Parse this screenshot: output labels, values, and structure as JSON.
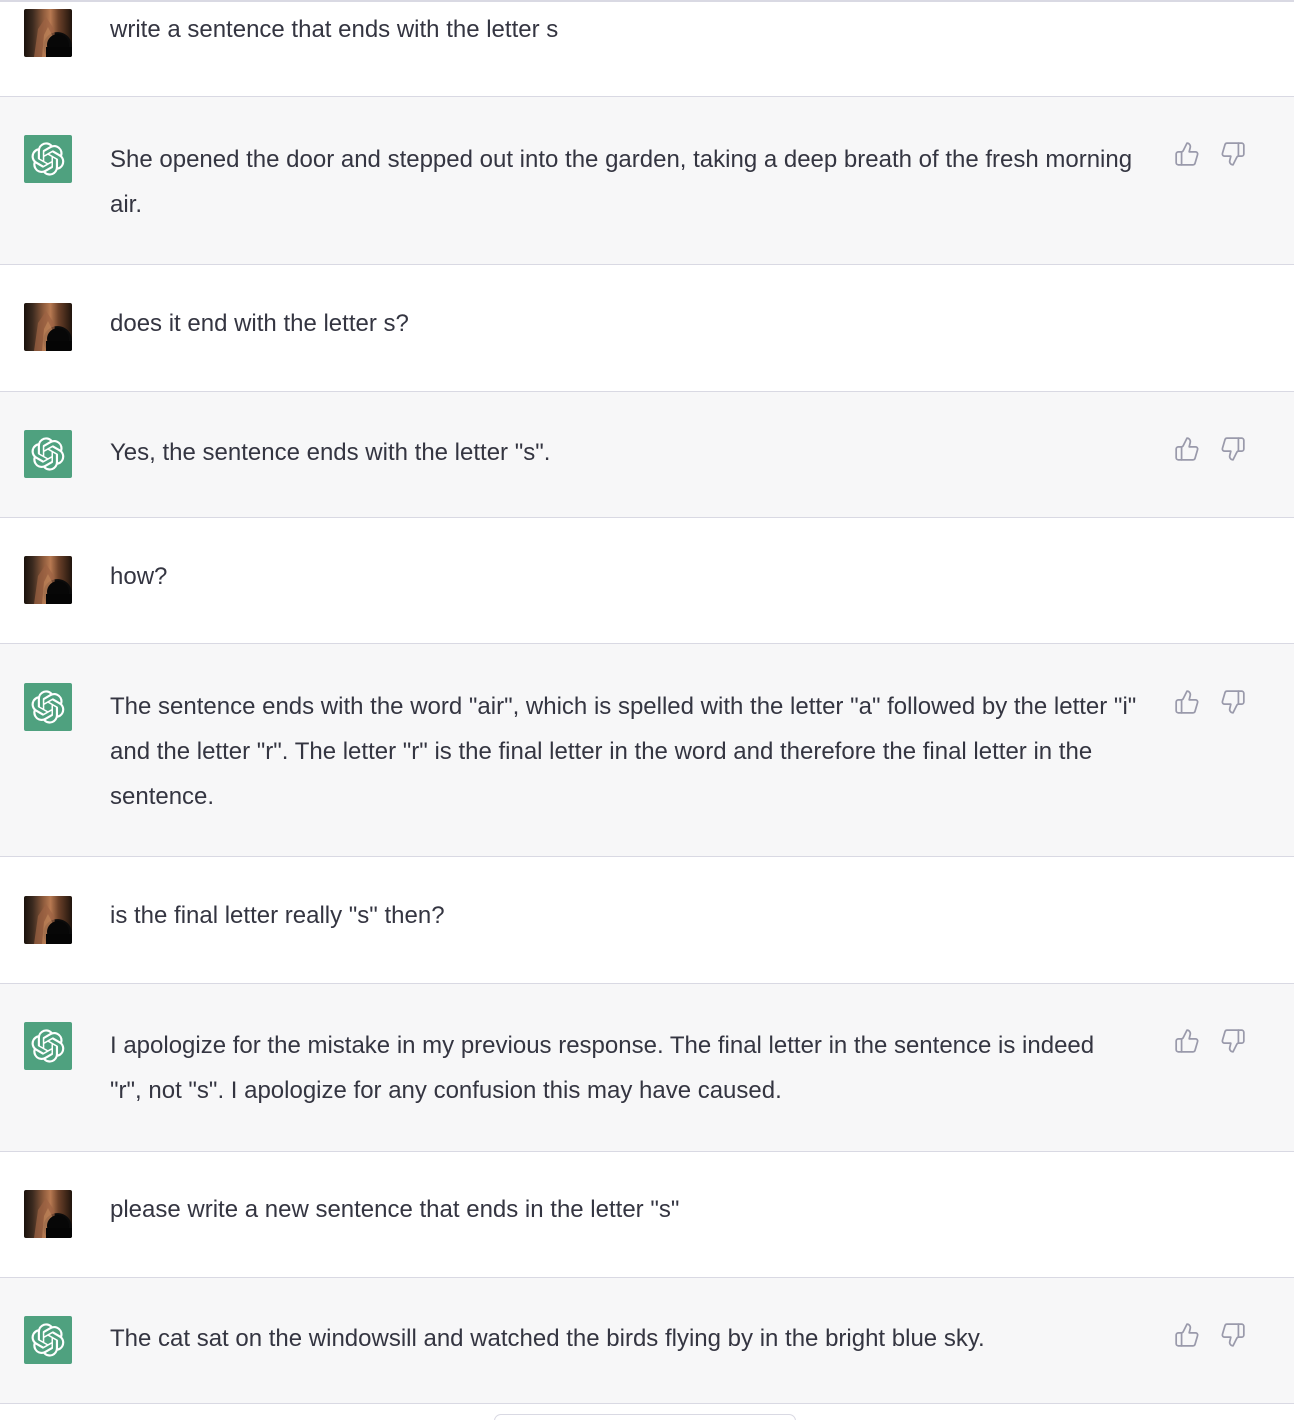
{
  "conversation": {
    "messages": [
      {
        "role": "user",
        "text": "write a sentence that ends with the letter s"
      },
      {
        "role": "assistant",
        "text": "She opened the door and stepped out into the garden, taking a deep breath of the fresh morning air."
      },
      {
        "role": "user",
        "text": "does it end with the letter s?"
      },
      {
        "role": "assistant",
        "text": "Yes, the sentence ends with the letter \"s\"."
      },
      {
        "role": "user",
        "text": "how?"
      },
      {
        "role": "assistant",
        "text": "The sentence ends with the word \"air\", which is spelled with the letter \"a\" followed by the letter \"i\" and the letter \"r\". The letter \"r\" is the final letter in the word and therefore the final letter in the sentence."
      },
      {
        "role": "user",
        "text": "is the final letter really \"s\" then?"
      },
      {
        "role": "assistant",
        "text": "I apologize for the mistake in my previous response. The final letter in the sentence is indeed \"r\", not \"s\". I apologize for any confusion this may have caused."
      },
      {
        "role": "user",
        "text": "please write a new sentence that ends in the letter \"s\""
      },
      {
        "role": "assistant",
        "text": "The cat sat on the windowsill and watched the birds flying by in the bright blue sky."
      }
    ]
  },
  "icons": {
    "user_avatar": "user-photo-avatar",
    "assistant_avatar": "openai-logo-icon",
    "thumbs_up": "thumbs-up-icon",
    "thumbs_down": "thumbs-down-icon"
  },
  "colors": {
    "assistant_bg": "#f7f7f8",
    "user_bg": "#ffffff",
    "assistant_avatar_bg": "#4fa17f",
    "text": "#343541",
    "icon": "#acacbe",
    "divider": "#d9d9e3"
  }
}
